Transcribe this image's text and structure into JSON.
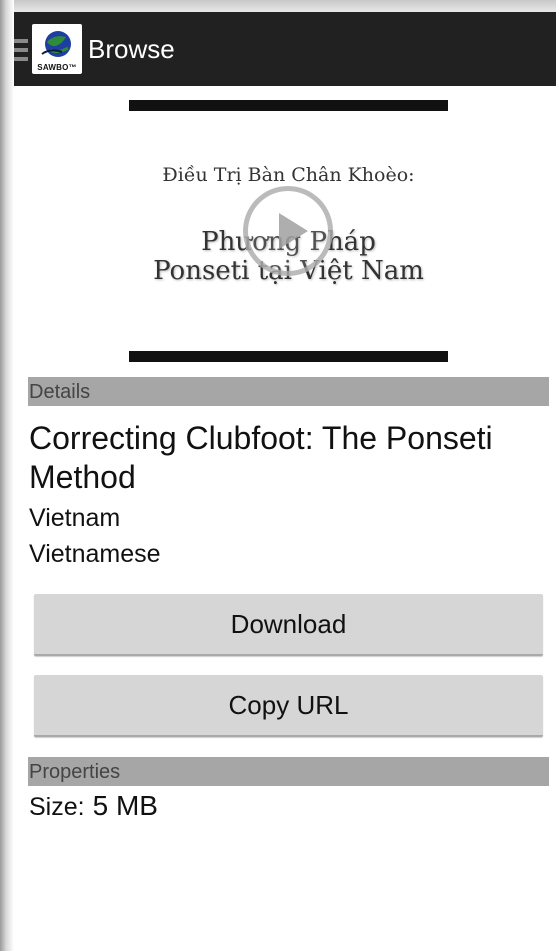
{
  "appbar": {
    "title": "Browse",
    "logo_text": "SAWBO™",
    "icons": [
      "drawer-icon",
      "sawbo-logo"
    ]
  },
  "video": {
    "frame_line1": "Điều Trị Bàn Chân Khoèo:",
    "frame_line2": "Phương Pháp",
    "frame_line3": "Ponseti tại Việt Nam",
    "play_icon": "play-icon"
  },
  "details": {
    "header": "Details",
    "title": "Correcting Clubfoot: The Ponseti Method",
    "country": "Vietnam",
    "language": "Vietnamese",
    "download_label": "Download",
    "copy_url_label": "Copy URL"
  },
  "properties": {
    "header": "Properties",
    "size_label": "Size:",
    "size_value": "5 MB"
  },
  "colors": {
    "appbar": "#212121",
    "section_header": "#a6a6a6",
    "button": "#d6d6d6"
  }
}
